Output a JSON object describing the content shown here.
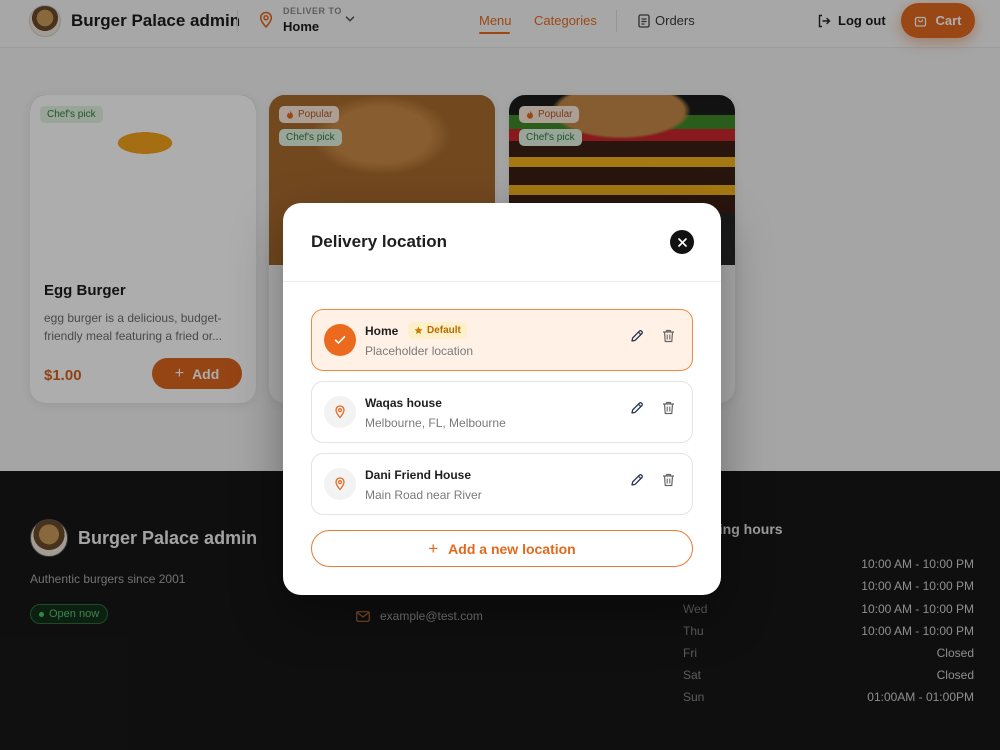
{
  "header": {
    "brand_name": "Burger Palace admin",
    "deliver_caption": "DELIVER TO",
    "deliver_value": "Home",
    "nav": {
      "menu": "Menu",
      "categories": "Categories",
      "orders": "Orders"
    },
    "logout": "Log out",
    "cart": "Cart"
  },
  "colors": {
    "accent": "#e2691e",
    "footer_bg": "#171717",
    "success": "#4cc86a"
  },
  "cards": [
    {
      "title": "Egg Burger",
      "description": "egg burger is a delicious, budget-friendly meal featuring a fried or...",
      "price": "$1.00",
      "add_label": "Add",
      "badges": [
        "Chef's pick"
      ]
    },
    {
      "badges": [
        "Popular",
        "Chef's pick"
      ]
    },
    {
      "badges": [
        "Popular",
        "Chef's pick"
      ]
    }
  ],
  "footer": {
    "brand_name": "Burger Palace admin",
    "tagline": "Authentic burgers since 2001",
    "open_status": "Open now",
    "email": "example@test.com",
    "hours_title": "Opening hours",
    "hours": [
      {
        "day": "",
        "time": "10:00 AM - 10:00 PM"
      },
      {
        "day": "",
        "time": "10:00 AM - 10:00 PM"
      },
      {
        "day": "Wed",
        "time": "10:00 AM - 10:00 PM"
      },
      {
        "day": "Thu",
        "time": "10:00 AM - 10:00 PM"
      },
      {
        "day": "Fri",
        "time": "Closed"
      },
      {
        "day": "Sat",
        "time": "Closed"
      },
      {
        "day": "Sun",
        "time": "01:00AM - 01:00PM"
      }
    ]
  },
  "modal": {
    "title": "Delivery location",
    "locations": [
      {
        "name": "Home",
        "address": "Placeholder location",
        "default_label": "Default",
        "selected": true
      },
      {
        "name": "Waqas house",
        "address": "Melbourne, FL, Melbourne",
        "selected": false
      },
      {
        "name": "Dani Friend House",
        "address": "Main Road near River",
        "selected": false
      }
    ],
    "add_label": "Add a new location"
  }
}
